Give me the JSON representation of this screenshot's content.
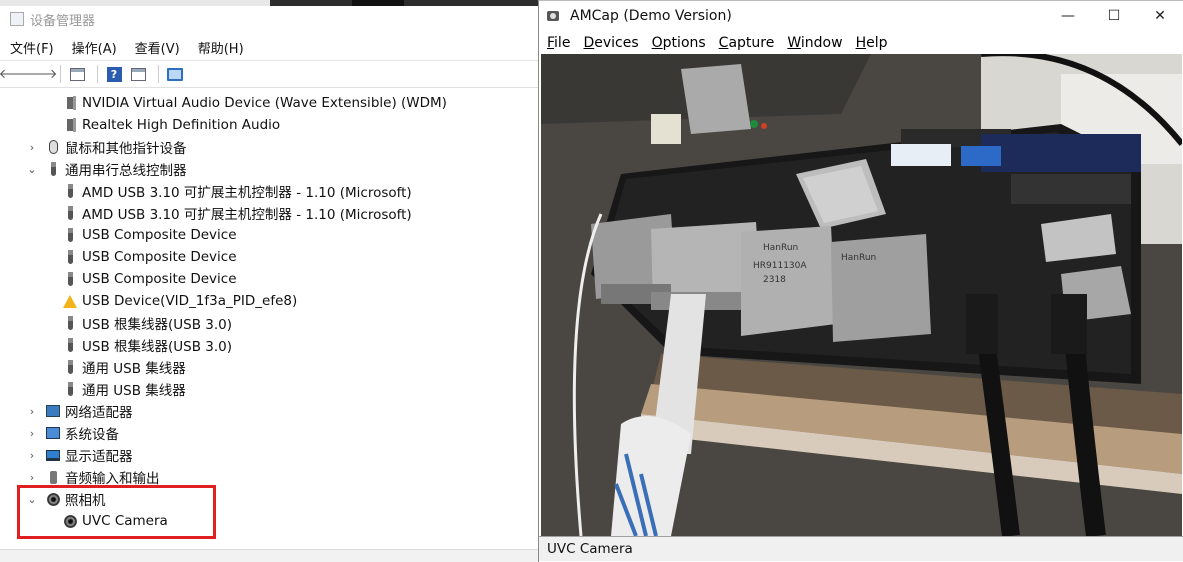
{
  "device_manager": {
    "title": "设备管理器",
    "menu": [
      "文件(F)",
      "操作(A)",
      "查看(V)",
      "帮助(H)"
    ],
    "tree": [
      {
        "label": "NVIDIA Virtual Audio Device (Wave Extensible) (WDM)",
        "icon": "speaker-icon",
        "indent": 2,
        "expander": ""
      },
      {
        "label": "Realtek High Definition Audio",
        "icon": "speaker-icon",
        "indent": 2,
        "expander": ""
      },
      {
        "label": "鼠标和其他指针设备",
        "icon": "mouse-icon",
        "indent": 1,
        "expander": "›"
      },
      {
        "label": "通用串行总线控制器",
        "icon": "usb-icon",
        "indent": 1,
        "expander": "⌄"
      },
      {
        "label": "AMD USB 3.10 可扩展主机控制器 - 1.10 (Microsoft)",
        "icon": "usb-icon",
        "indent": 2,
        "expander": ""
      },
      {
        "label": "AMD USB 3.10 可扩展主机控制器 - 1.10 (Microsoft)",
        "icon": "usb-icon",
        "indent": 2,
        "expander": ""
      },
      {
        "label": "USB Composite Device",
        "icon": "usb-icon",
        "indent": 2,
        "expander": ""
      },
      {
        "label": "USB Composite Device",
        "icon": "usb-icon",
        "indent": 2,
        "expander": ""
      },
      {
        "label": "USB Composite Device",
        "icon": "usb-icon",
        "indent": 2,
        "expander": ""
      },
      {
        "label": "USB Device(VID_1f3a_PID_efe8)",
        "icon": "warning-icon",
        "indent": 2,
        "expander": ""
      },
      {
        "label": "USB 根集线器(USB 3.0)",
        "icon": "usb-icon",
        "indent": 2,
        "expander": ""
      },
      {
        "label": "USB 根集线器(USB 3.0)",
        "icon": "usb-icon",
        "indent": 2,
        "expander": ""
      },
      {
        "label": "通用 USB 集线器",
        "icon": "usb-icon",
        "indent": 2,
        "expander": ""
      },
      {
        "label": "通用 USB 集线器",
        "icon": "usb-icon",
        "indent": 2,
        "expander": ""
      },
      {
        "label": "网络适配器",
        "icon": "network-adapter-icon",
        "indent": 1,
        "expander": "›"
      },
      {
        "label": "系统设备",
        "icon": "system-device-icon",
        "indent": 1,
        "expander": "›"
      },
      {
        "label": "显示适配器",
        "icon": "display-adapter-icon",
        "indent": 1,
        "expander": "›"
      },
      {
        "label": "音频输入和输出",
        "icon": "audio-io-icon",
        "indent": 1,
        "expander": "›"
      },
      {
        "label": "照相机",
        "icon": "camera-icon",
        "indent": 1,
        "expander": "⌄"
      },
      {
        "label": "UVC Camera",
        "icon": "camera-icon",
        "indent": 2,
        "expander": ""
      }
    ],
    "highlight_color": "#e02020"
  },
  "amcap": {
    "title": "AMCap (Demo Version)",
    "menu": [
      {
        "hot": "F",
        "rest": "ile"
      },
      {
        "hot": "D",
        "rest": "evices"
      },
      {
        "hot": "O",
        "rest": "ptions"
      },
      {
        "hot": "C",
        "rest": "apture"
      },
      {
        "hot": "W",
        "rest": "indow"
      },
      {
        "hot": "H",
        "rest": "elp"
      }
    ],
    "status": "UVC Camera",
    "video_labels": {
      "chip_brand": "HanRun",
      "chip_model": "HR911130A",
      "chip_code": "2318"
    }
  }
}
